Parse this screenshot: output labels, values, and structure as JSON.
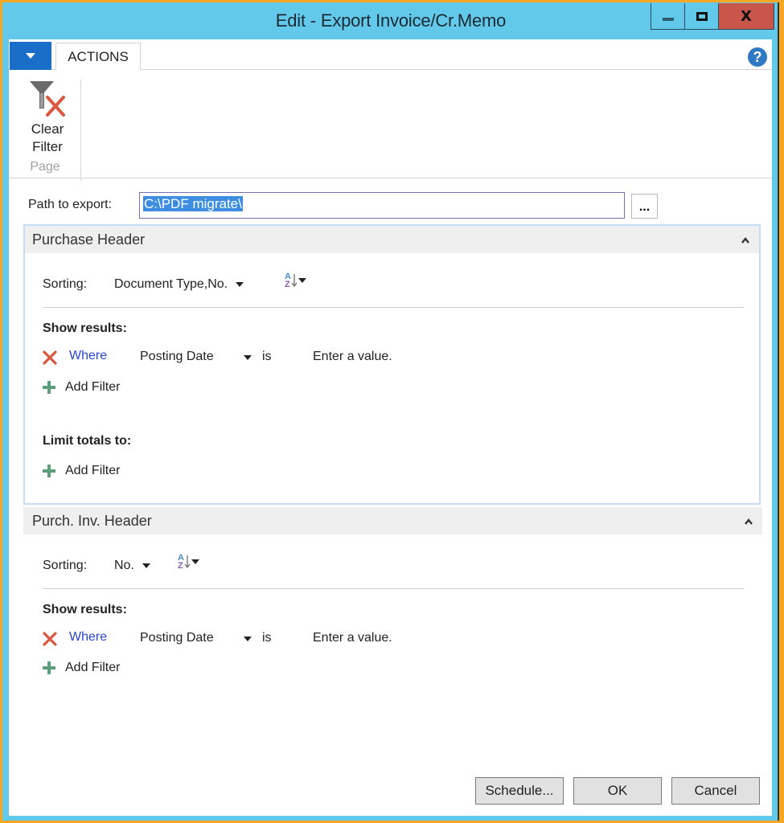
{
  "window": {
    "title": "Edit - Export Invoice/Cr.Memo",
    "minimize_label": "minimize",
    "maximize_label": "maximize",
    "close_label": "X"
  },
  "ribbon": {
    "tabs": [
      {
        "label": "ACTIONS",
        "active": true
      }
    ],
    "help_label": "?",
    "groups": [
      {
        "label": "Page",
        "actions": [
          {
            "label_line1": "Clear",
            "label_line2": "Filter",
            "icon": "clear-filter-icon"
          }
        ]
      }
    ]
  },
  "path": {
    "label": "Path to export:",
    "value": "C:\\PDF migrate\\",
    "assist_label": "..."
  },
  "fasttabs": [
    {
      "title": "Purchase Header",
      "expanded": true,
      "sorting_label": "Sorting:",
      "sorting_value": "Document Type,No.",
      "show_results_label": "Show results:",
      "filters": [
        {
          "where_label": "Where",
          "field": "Posting Date",
          "operator": "is",
          "value_placeholder": "Enter a value."
        }
      ],
      "add_filter_label": "Add Filter",
      "limit_totals_label": "Limit totals to:",
      "limit_add_filter_label": "Add Filter"
    },
    {
      "title": "Purch. Inv. Header",
      "expanded": true,
      "sorting_label": "Sorting:",
      "sorting_value": "No.",
      "show_results_label": "Show results:",
      "filters": [
        {
          "where_label": "Where",
          "field": "Posting Date",
          "operator": "is",
          "value_placeholder": "Enter a value."
        }
      ],
      "add_filter_label": "Add Filter"
    }
  ],
  "footer": {
    "schedule_label": "Schedule...",
    "ok_label": "OK",
    "cancel_label": "Cancel"
  },
  "colors": {
    "title_bar": "#63c9eb",
    "close_button": "#c8564b",
    "app_menu": "#1a6ec7",
    "link": "#2846d8",
    "selection": "#3d8ee0"
  }
}
